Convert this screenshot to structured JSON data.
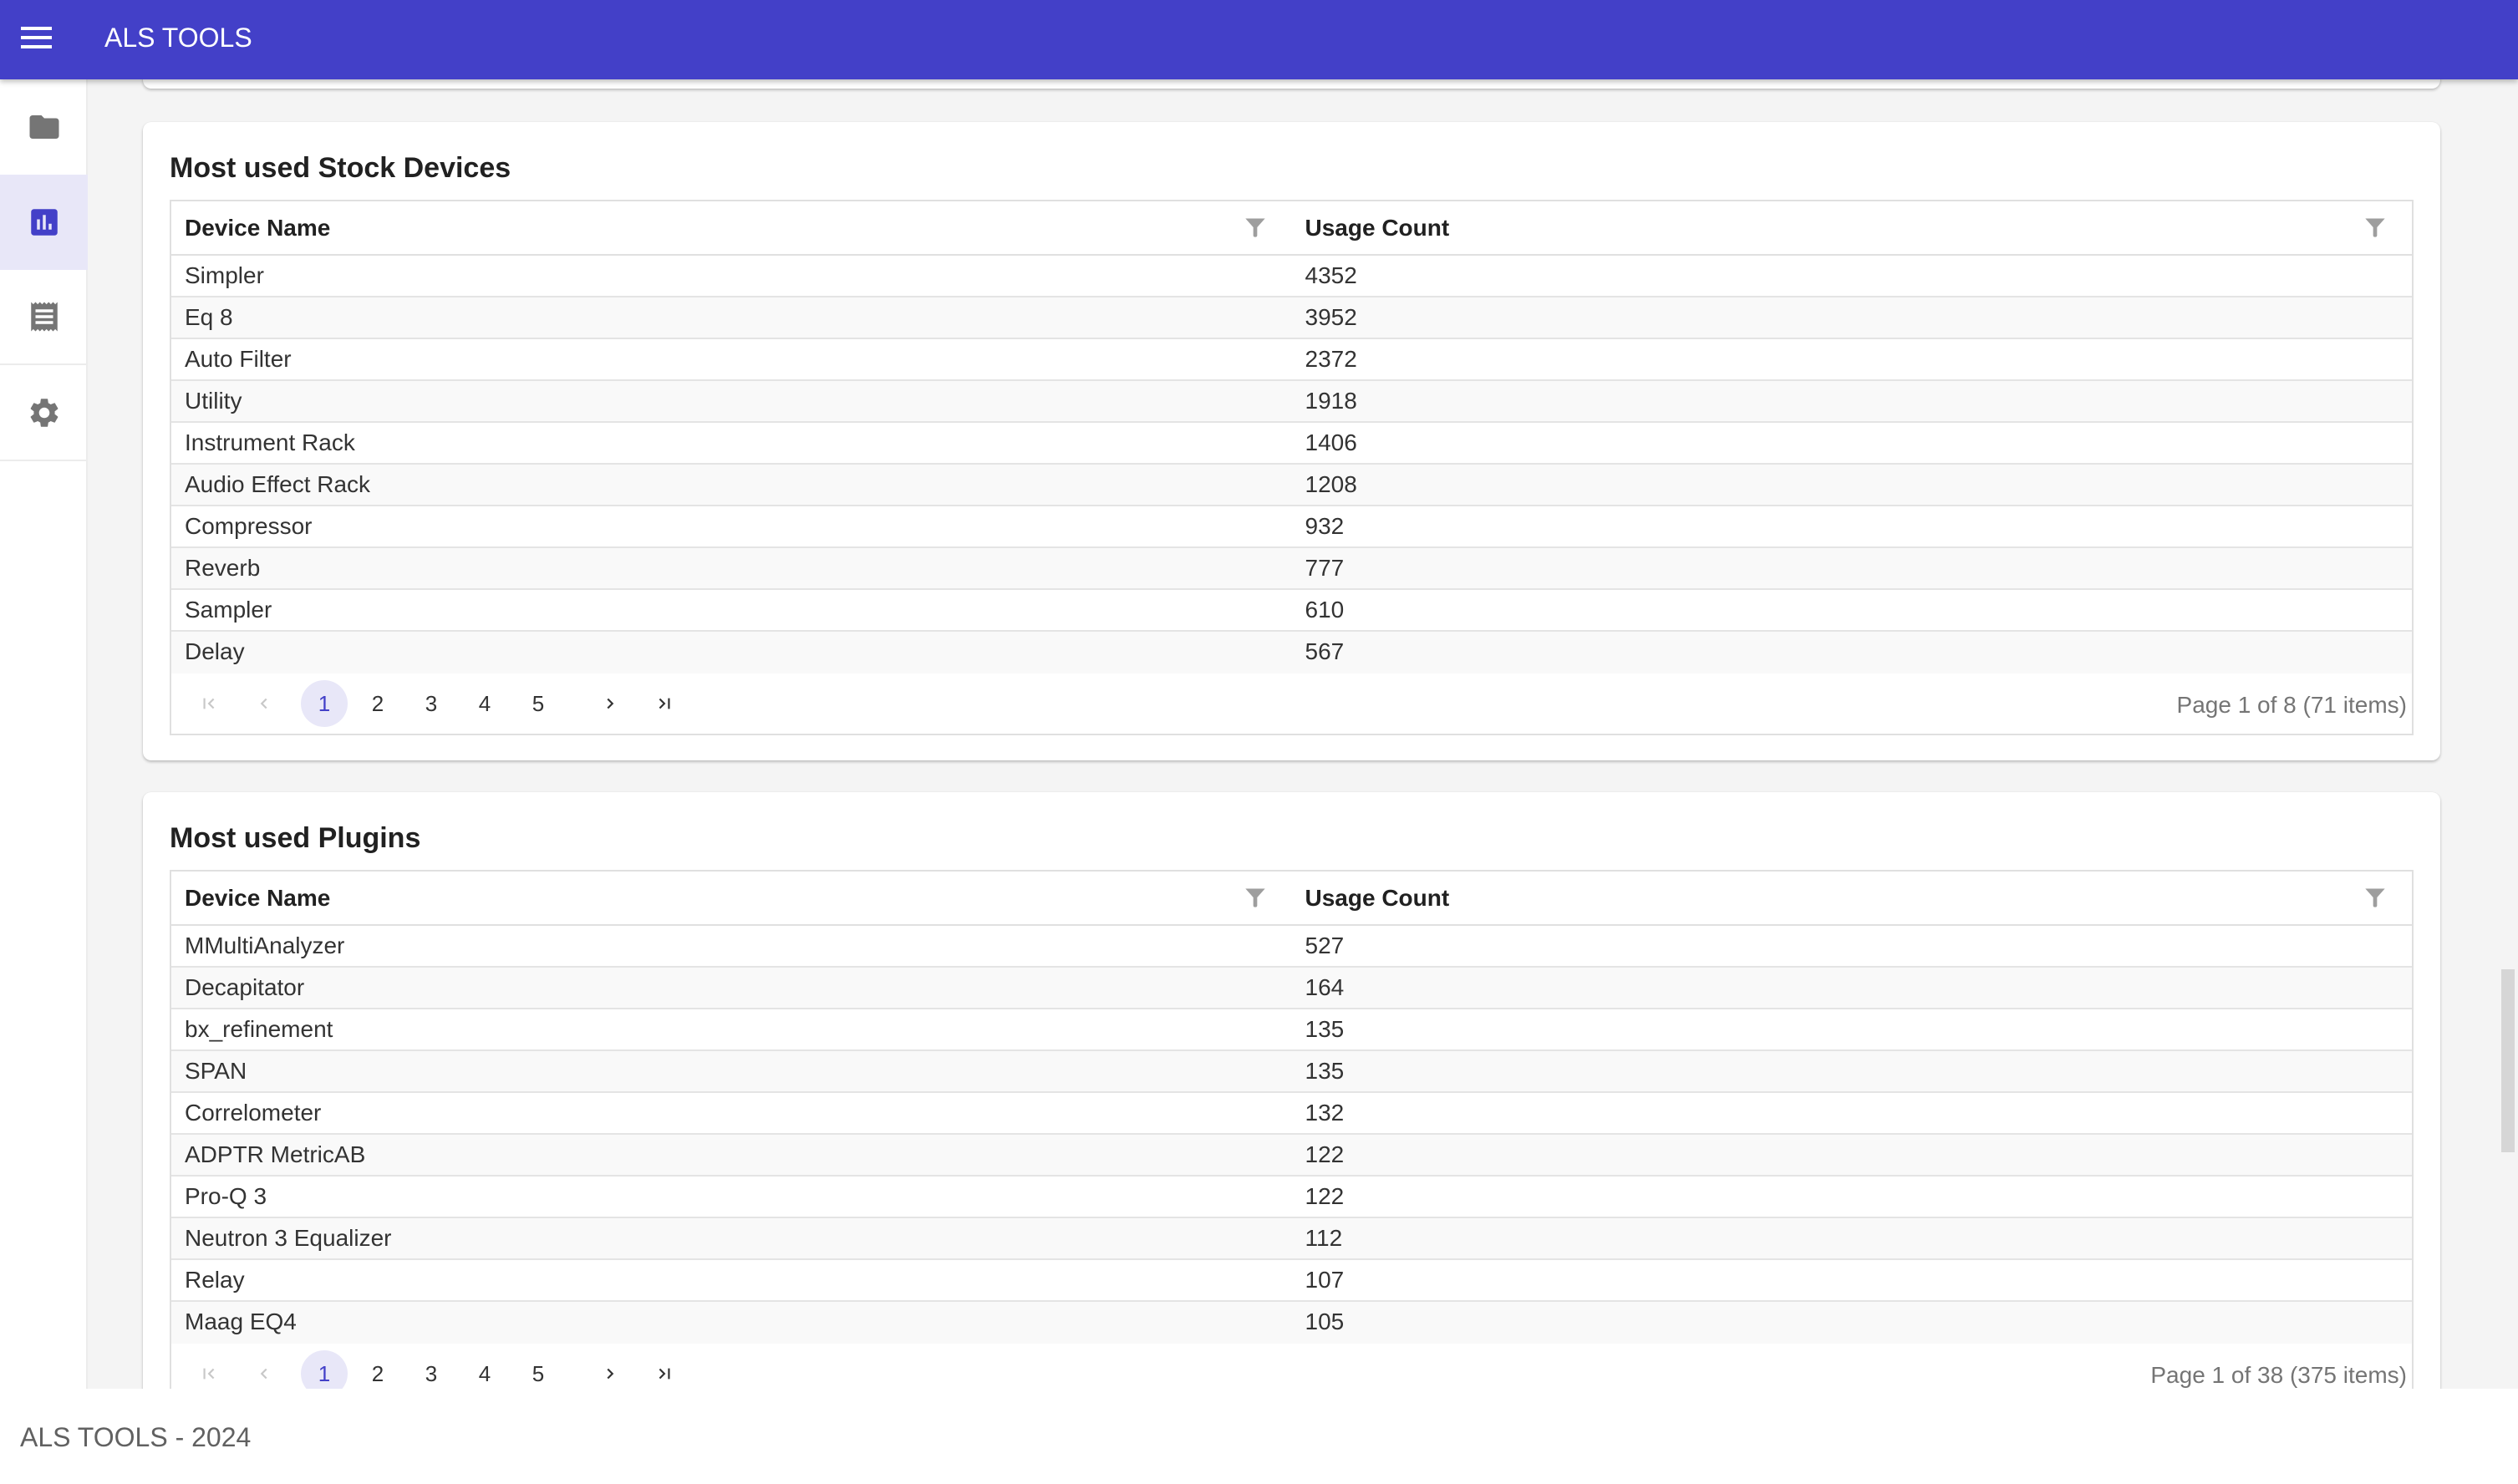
{
  "app": {
    "title": "ALS TOOLS",
    "footer": "ALS TOOLS - 2024",
    "accent_color": "#4340c8"
  },
  "sidebar": {
    "items": [
      {
        "name": "projects",
        "icon": "folder-icon",
        "selected": false
      },
      {
        "name": "statistics",
        "icon": "bar-chart-icon",
        "selected": true
      },
      {
        "name": "reports",
        "icon": "receipt-icon",
        "selected": false
      },
      {
        "name": "settings",
        "icon": "gear-icon",
        "selected": false
      }
    ]
  },
  "stock_devices": {
    "title": "Most used Stock Devices",
    "columns": [
      "Device Name",
      "Usage Count"
    ],
    "rows": [
      [
        "Simpler",
        "4352"
      ],
      [
        "Eq 8",
        "3952"
      ],
      [
        "Auto Filter",
        "2372"
      ],
      [
        "Utility",
        "1918"
      ],
      [
        "Instrument Rack",
        "1406"
      ],
      [
        "Audio Effect Rack",
        "1208"
      ],
      [
        "Compressor",
        "932"
      ],
      [
        "Reverb",
        "777"
      ],
      [
        "Sampler",
        "610"
      ],
      [
        "Delay",
        "567"
      ]
    ],
    "pager": {
      "pages": [
        "1",
        "2",
        "3",
        "4",
        "5"
      ],
      "current": "1",
      "info": "Page 1 of 8 (71 items)"
    }
  },
  "plugins": {
    "title": "Most used Plugins",
    "columns": [
      "Device Name",
      "Usage Count"
    ],
    "rows": [
      [
        "MMultiAnalyzer",
        "527"
      ],
      [
        "Decapitator",
        "164"
      ],
      [
        "bx_refinement",
        "135"
      ],
      [
        "SPAN",
        "135"
      ],
      [
        "Correlometer",
        "132"
      ],
      [
        "ADPTR MetricAB",
        "122"
      ],
      [
        "Pro-Q 3",
        "122"
      ],
      [
        "Neutron 3 Equalizer",
        "112"
      ],
      [
        "Relay",
        "107"
      ],
      [
        "Maag EQ4",
        "105"
      ]
    ],
    "pager": {
      "pages": [
        "1",
        "2",
        "3",
        "4",
        "5"
      ],
      "current": "1",
      "info": "Page 1 of 38 (375 items)"
    }
  },
  "scrollbar": {
    "position_fraction": 0.79,
    "visible_fraction": 0.14
  }
}
